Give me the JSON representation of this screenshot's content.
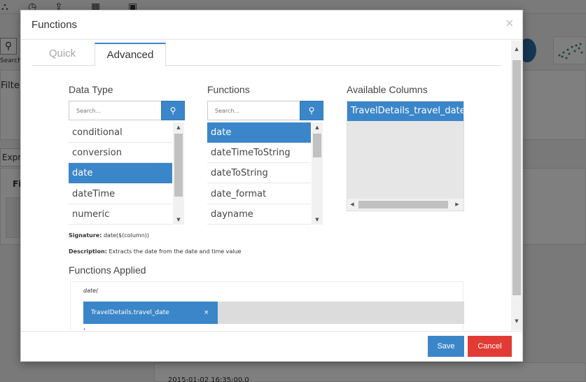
{
  "background": {
    "search_label": "Search",
    "filter_label": "Filte",
    "expr_tab_label": "Expr",
    "fi_label": "Fi",
    "date_text": "2015-01-02 16:35:00.0"
  },
  "modal": {
    "title": "Functions",
    "close_glyph": "×",
    "tabs": [
      {
        "label": "Quick",
        "active": false
      },
      {
        "label": "Advanced",
        "active": true
      }
    ],
    "data_type": {
      "heading": "Data Type",
      "search_placeholder": "Search...",
      "items": [
        {
          "label": "conditional",
          "selected": false
        },
        {
          "label": "conversion",
          "selected": false
        },
        {
          "label": "date",
          "selected": true
        },
        {
          "label": "dateTime",
          "selected": false
        },
        {
          "label": "numeric",
          "selected": false
        }
      ]
    },
    "functions": {
      "heading": "Functions",
      "search_placeholder": "Search...",
      "items": [
        {
          "label": "date",
          "selected": true
        },
        {
          "label": "dateTimeToString",
          "selected": false
        },
        {
          "label": "dateToString",
          "selected": false
        },
        {
          "label": "date_format",
          "selected": false
        },
        {
          "label": "dayname",
          "selected": false
        }
      ]
    },
    "available_columns": {
      "heading": "Available Columns",
      "items": [
        {
          "label": "TravelDetails_travel_date",
          "selected": true
        }
      ]
    },
    "signature": {
      "label": "Signature:",
      "value": "date($(column))"
    },
    "description": {
      "label": "Description:",
      "value": "Extracts the date from the date and time value"
    },
    "functions_applied": {
      "heading": "Functions Applied",
      "open_text": "date(",
      "chip_label": "TravelDetails.travel_date",
      "chip_remove": "×",
      "close_text": ")"
    },
    "footer": {
      "save_label": "Save",
      "cancel_label": "Cancel"
    },
    "colors": {
      "accent": "#3b86c9",
      "danger": "#e23b36",
      "chip_row_bg": "#dcdcdc"
    }
  }
}
